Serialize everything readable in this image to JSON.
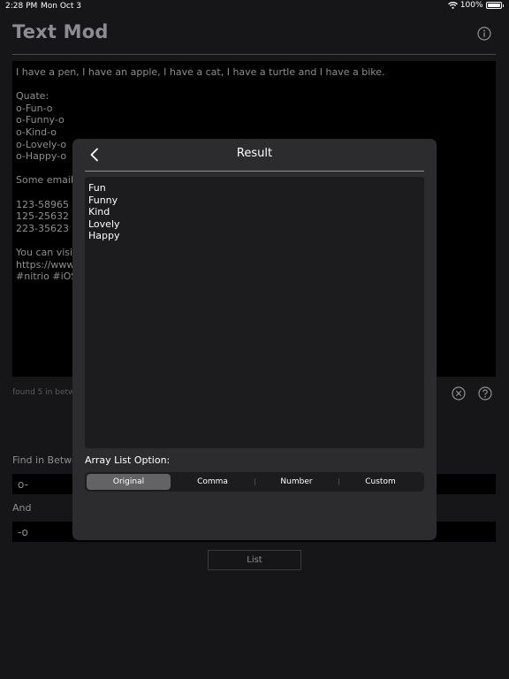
{
  "status_bar": {
    "time": "2:28 PM",
    "date": "Mon Oct 3",
    "battery": "100%"
  },
  "header": {
    "title": "Text Mod",
    "info_icon": "info-icon"
  },
  "main": {
    "text": "I have a pen, I have an apple, I have a cat, I have a turtle and I have a bike.\n\nQuate:\no-Fun-o\no-Funny-o\no-Kind-o\no-Lovely-o\no-Happy-o\n\nSome email s\n\n123-58965\n125-25632\n223-35623\n\nYou can visit\nhttps://www.\n#nitrio #iOS",
    "found_text": "found 5 in betw",
    "find_label": "Find in Betwe",
    "find_value": "o-",
    "and_label": "And",
    "and_value": "-o",
    "list_button": "List"
  },
  "modal": {
    "title": "Result",
    "result_lines": [
      "Fun",
      "Funny",
      "Kind",
      "Lovely",
      "Happy"
    ],
    "option_label": "Array List Option:",
    "segments": [
      {
        "label": "Original",
        "selected": true
      },
      {
        "label": "Comma",
        "selected": false
      },
      {
        "label": "Number",
        "selected": false
      },
      {
        "label": "Custom",
        "selected": false
      }
    ]
  },
  "colors": {
    "background": "#161618",
    "modal": "#2c2c2e",
    "selected_segment": "#636366",
    "text_primary": "#ffffff",
    "text_secondary": "#8e8e93"
  }
}
